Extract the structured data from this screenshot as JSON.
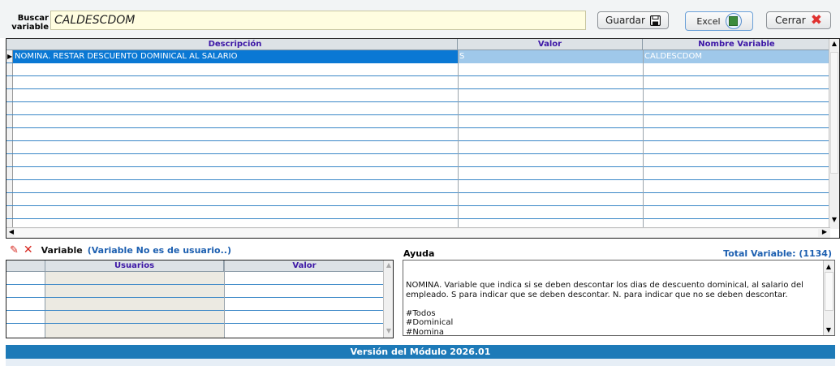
{
  "search": {
    "label_line1": "Buscar",
    "label_line2": "variable",
    "value": "CALDESCDOM"
  },
  "toolbar": {
    "save_label": "Guardar",
    "save_icon": "floppy-disk-icon",
    "excel_label": "Excel",
    "excel_icon": "excel-icon",
    "close_label": "Cerrar",
    "close_icon": "close-x-icon"
  },
  "grid": {
    "columns": [
      "Descripción",
      "Valor",
      "Nombre Variable"
    ],
    "rows": [
      {
        "descripcion": "NOMINA. RESTAR DESCUENTO DOMINICAL AL SALARIO",
        "valor": "S",
        "nombre": "CALDESCDOM",
        "selected": true
      }
    ]
  },
  "variable_panel": {
    "label": "Variable",
    "note": "(Variable No es de usuario..)",
    "columns": [
      "Usuarios",
      "Valor"
    ]
  },
  "ayuda": {
    "label": "Ayuda",
    "total": "Total Variable: (1134)",
    "text": "NOMINA. Variable que indica si se deben descontar los dias de descuento dominical, al salario del empleado. S para indicar que se deben descontar. N. para indicar que no se deben descontar.\n\n#Todos\n#Dominical\n#Nomina\nCALDESCDOM"
  },
  "footer": {
    "version": "Versión del Módulo 2026.01"
  },
  "colors": {
    "header_text": "#3c16a6",
    "selection": "#0a78d4",
    "selection_light": "#9fc8ea",
    "row_line": "#3a87c7",
    "footer_bg": "#1d7ab8",
    "accent_red": "#e0312f"
  }
}
